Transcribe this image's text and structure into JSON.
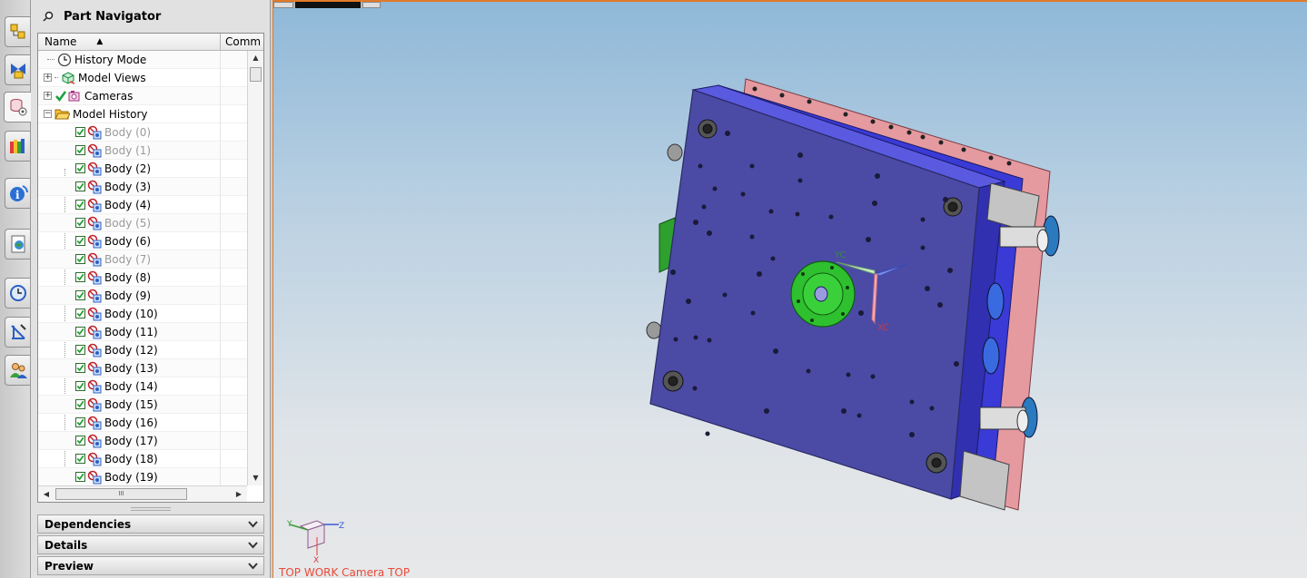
{
  "navigator": {
    "title": "Part Navigator",
    "columns": {
      "name": "Name",
      "comment": "Comm"
    },
    "top_items": [
      {
        "label": "History Mode",
        "icon": "clock-icon"
      },
      {
        "label": "Model Views",
        "icon": "model-views-icon",
        "expandable": true
      },
      {
        "label": "Cameras",
        "icon": "camera-icon",
        "expandable": true,
        "checked": true
      },
      {
        "label": "Model History",
        "icon": "folder-icon",
        "expandable": true,
        "expanded": true
      }
    ],
    "bodies": [
      {
        "label": "Body (0)",
        "dim": true
      },
      {
        "label": "Body (1)",
        "dim": true
      },
      {
        "label": "Body (2)",
        "dim": false
      },
      {
        "label": "Body (3)",
        "dim": false
      },
      {
        "label": "Body (4)",
        "dim": false
      },
      {
        "label": "Body (5)",
        "dim": true
      },
      {
        "label": "Body (6)",
        "dim": false
      },
      {
        "label": "Body (7)",
        "dim": true
      },
      {
        "label": "Body (8)",
        "dim": false
      },
      {
        "label": "Body (9)",
        "dim": false
      },
      {
        "label": "Body (10)",
        "dim": false
      },
      {
        "label": "Body (11)",
        "dim": false
      },
      {
        "label": "Body (12)",
        "dim": false
      },
      {
        "label": "Body (13)",
        "dim": false
      },
      {
        "label": "Body (14)",
        "dim": false
      },
      {
        "label": "Body (15)",
        "dim": false
      },
      {
        "label": "Body (16)",
        "dim": false
      },
      {
        "label": "Body (17)",
        "dim": false
      },
      {
        "label": "Body (18)",
        "dim": false
      },
      {
        "label": "Body (19)",
        "dim": false
      }
    ],
    "hscroll_grip": "III",
    "sections": {
      "dependencies": "Dependencies",
      "details": "Details",
      "preview": "Preview"
    }
  },
  "resource_bar": {
    "tabs": [
      "assembly-navigator-icon",
      "constraint-navigator-icon",
      "part-navigator-icon",
      "reuse-library-icon",
      "hd3d-tools-icon",
      "web-browser-icon",
      "history-icon",
      "process-studio-icon",
      "roles-icon"
    ]
  },
  "graphics": {
    "view_label": "TOP WORK Camera TOP",
    "wcs_labels": {
      "yc": "YC",
      "xc": "XC"
    },
    "triad_labels": {
      "x": "X",
      "y": "Y",
      "z": "Z"
    },
    "colors": {
      "plate": "#4b4ba6",
      "plate_edge": "#2a2a66",
      "pink_plate": "#e59aa0",
      "blue_plate": "#3a3ad6",
      "locating_ring": "#28c028",
      "accent_border": "#e07a2a"
    }
  }
}
